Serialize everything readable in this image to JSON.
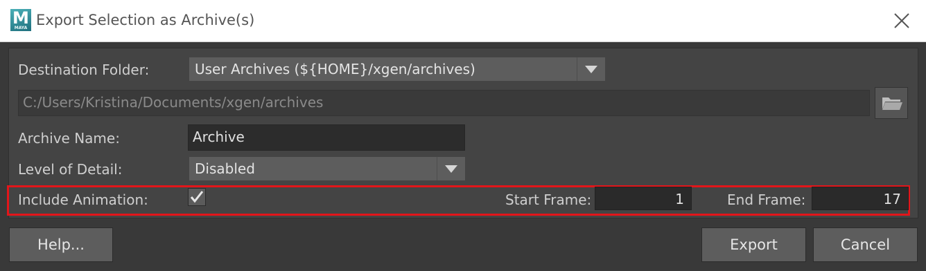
{
  "window": {
    "title": "Export Selection as Archive(s)",
    "logo_letter": "M",
    "logo_caption": "MAYA"
  },
  "form": {
    "destination_label": "Destination Folder:",
    "destination_value": "User Archives (${HOME}/xgen/archives)",
    "path_value": "C:/Users/Kristina/Documents/xgen/archives",
    "archive_name_label": "Archive Name:",
    "archive_name_value": "Archive",
    "lod_label": "Level of Detail:",
    "lod_value": "Disabled",
    "include_animation_label": "Include Animation:",
    "include_animation_checked": true,
    "start_frame_label": "Start Frame:",
    "start_frame_value": "1",
    "end_frame_label": "End Frame:",
    "end_frame_value": "17"
  },
  "buttons": {
    "help": "Help...",
    "export": "Export",
    "cancel": "Cancel"
  },
  "icons": {
    "close": "close-icon",
    "folder": "folder-icon",
    "dropdown": "chevron-down-icon",
    "check": "check-icon"
  },
  "colors": {
    "highlight": "#e3151a",
    "background": "#3c3c3c"
  }
}
